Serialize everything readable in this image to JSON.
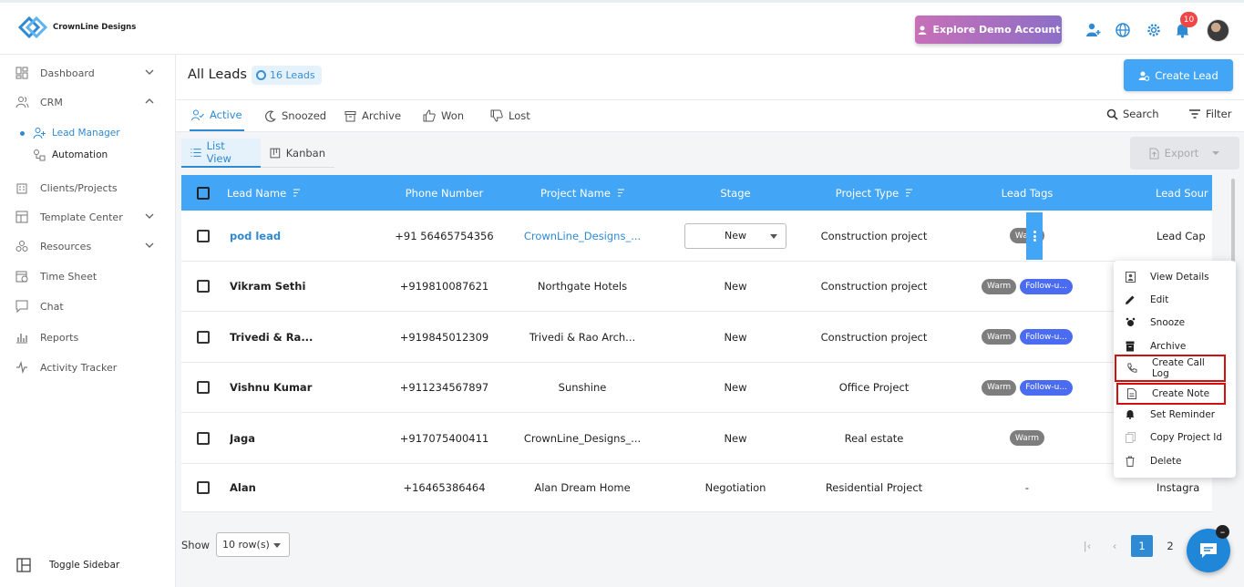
{
  "brand": {
    "name": "CrownLine Designs"
  },
  "topbar": {
    "demo_label": "Explore Demo Account",
    "notifications_count": "10"
  },
  "sidebar": {
    "items": [
      {
        "label": "Dashboard"
      },
      {
        "label": "CRM"
      },
      {
        "label": "Clients/Projects"
      },
      {
        "label": "Template Center"
      },
      {
        "label": "Resources"
      },
      {
        "label": "Time Sheet"
      },
      {
        "label": "Chat"
      },
      {
        "label": "Reports"
      },
      {
        "label": "Activity Tracker"
      }
    ],
    "crm_sub": [
      {
        "label": "Lead Manager"
      },
      {
        "label": "Automation"
      }
    ],
    "toggle_label": "Toggle Sidebar"
  },
  "header": {
    "title": "All Leads",
    "count": "16 Leads",
    "create_label": "Create Lead"
  },
  "tabs": [
    {
      "label": "Active"
    },
    {
      "label": "Snoozed"
    },
    {
      "label": "Archive"
    },
    {
      "label": "Won"
    },
    {
      "label": "Lost"
    }
  ],
  "tools": {
    "search": "Search",
    "filter": "Filter"
  },
  "views": [
    {
      "label": "List View"
    },
    {
      "label": "Kanban"
    }
  ],
  "export_label": "Export",
  "table": {
    "columns": [
      "Lead Name",
      "Phone Number",
      "Project Name",
      "Stage",
      "Project Type",
      "Lead Tags",
      "Lead Sour"
    ],
    "rows": [
      {
        "name": "pod lead",
        "phone": "+91 56465754356",
        "project": "CrownLine_Designs_...",
        "stage": "New",
        "type": "Construction project",
        "tags": [
          "Warm"
        ],
        "source": "Lead Cap"
      },
      {
        "name": "Vikram Sethi",
        "phone": "+919810087621",
        "project": "Northgate Hotels",
        "stage": "New",
        "type": "Construction project",
        "tags": [
          "Warm",
          "Follow-u..."
        ],
        "source": ""
      },
      {
        "name": "Trivedi & Ra...",
        "phone": "+919845012309",
        "project": "Trivedi & Rao Arch...",
        "stage": "New",
        "type": "Construction project",
        "tags": [
          "Warm",
          "Follow-u..."
        ],
        "source": ""
      },
      {
        "name": "Vishnu Kumar",
        "phone": "+911234567897",
        "project": "Sunshine",
        "stage": "New",
        "type": "Office Project",
        "tags": [
          "Warm",
          "Follow-u..."
        ],
        "source": ""
      },
      {
        "name": "Jaga",
        "phone": "+917075400411",
        "project": "CrownLine_Designs_...",
        "stage": "New",
        "type": "Real estate",
        "tags": [
          "Warm"
        ],
        "source": ""
      },
      {
        "name": "Alan",
        "phone": "+16465386464",
        "project": "Alan Dream Home",
        "stage": "Negotiation",
        "type": "Residential Project",
        "tags": [],
        "tags_text": "-",
        "source": "Instagra"
      }
    ]
  },
  "menu": [
    {
      "label": "View Details"
    },
    {
      "label": "Edit"
    },
    {
      "label": "Snooze"
    },
    {
      "label": "Archive"
    },
    {
      "label": "Create Call Log"
    },
    {
      "label": "Create Note"
    },
    {
      "label": "Set Reminder"
    },
    {
      "label": "Copy Project Id"
    },
    {
      "label": "Delete"
    }
  ],
  "footer": {
    "show_label": "Show",
    "rows_value": "10 row(s)",
    "pages": [
      "1",
      "2"
    ]
  },
  "colors": {
    "accent": "#42a5f5",
    "link": "#2f8ad4",
    "highlight_border": "#d10f0f"
  }
}
